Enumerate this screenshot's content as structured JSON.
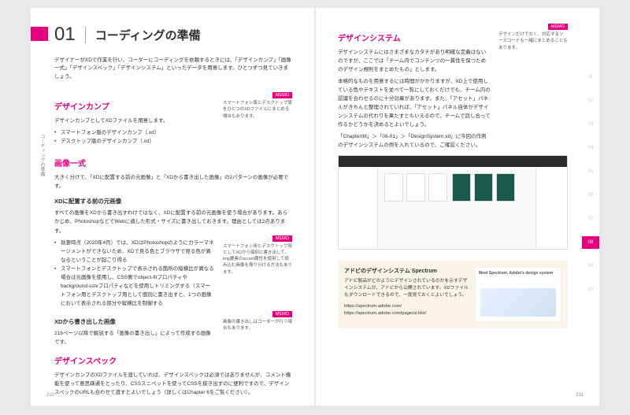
{
  "chapter": {
    "num": "01",
    "title": "コーディングの準備"
  },
  "intro": "デザイナーがXDで作業を行い、コーダーにコーディングを依頼するときには、「デザインカンプ」「画像一式」「デザインスペック」「デザインシステム」といったデータを用意します。ひとつずつ見ていきましょう。",
  "sideLabel": "コーディングの準備",
  "left": {
    "s1": {
      "h": "デザインカンプ",
      "p": "デザインカンプとしてXDファイルを用意します。",
      "b1": "スマートフォン版のデザインカンプ（.xd）",
      "b2": "デスクトップ版のデザインカンプ（.xd）",
      "memo": {
        "tag": "MEMO",
        "body": "スマートフォン版とデスクトップ版をひとつのXDファイルにまとめる場合もあります。"
      }
    },
    "s2": {
      "h": "画像一式",
      "p1": "大きく分けて、「XDに配置する前の元画像」と「XDから書き出した画像」の2パターンの画像が必要です。",
      "sub1": "XDに配置する前の元画像",
      "p2": "すべての画像をXDから書き出すわけではなく、XDに配置する前の元画像を使う場合があります。あらかじめ、PhotoshopなどでWebに適した形式・サイズに書き出しておきます。理由としては2点あります。",
      "b1": "執筆時点（2020年4月）では、XDはPhotoshopのようにカラーマネージメントができないため、XDで見る色とブラウザで見る色が異なるということが起こり得る",
      "b2": "スマートフォンとデスクトップで表示される箇所の縦横比が異なる場合は元画像を使用し、CSS側でobject-fitプロパティやbackground-sizeプロパティなどを使用しトリミングする（スマートフォン用とデスクトップ用として個別に書き出すと、1つの画像において表示される部分や縦横比を制御する",
      "memo1": {
        "tag": "MEMO",
        "body": "スマートフォン用とデスクトップ用としてXDから個別に書き出して、img要素のsrcset属性を使用して読み込む画像を振り分ける方法もあります。"
      },
      "sub2": "XDから書き出した画像",
      "p3": "216ページ以降で解説する「画像の書き出し」によって作成する画像です。",
      "memo2": {
        "tag": "MEMO",
        "body": "画像の書き出しはコーダーが行う場合もあります。"
      }
    },
    "s3": {
      "h": "デザインスペック",
      "p": "デザインカンプのXDファイルを渡していれば、デザインスペックは必須ではありませんが、コメント機能を使って意思疎通をとったり、CSSスニペットを使ってCSSを抜き出すのに便利ですので、デザインスペックのURLも合わせて渡すとよいでしょう（詳しくはChapter 6をご覧ください）。"
    }
  },
  "right": {
    "s4": {
      "h": "デザインシステム",
      "p1": "デザインシステムにはさまざまなカタチがあり明確な定義はないのですが、ここでは「チーム内でコンテンツの一貫性を保つためのデザイン規則をまとめたもの」とします。",
      "p2": "本格的なものを用意するには時間がかかりますが、XD上で使用している色やテキストを並べて一覧にしておくだけでも、チーム内の認識を合わせるのに十分効果があります。また、「アセット」パネルがきちんと整理されていれば、「アセット」パネル自体がデザインシステムの代わりを果たすともいえるので、チームで話し合って作るかどうかを決めるとよいでしょう。",
      "p3": "「Chapter08」＞「08-01」＞「DesignSystem.xd」に今回の作例のデザインシステムの例を入れているので、ご確認ください。",
      "memo": {
        "tag": "MEMO",
        "body": "デザインだけでなく、対応するソースコードも一緒にまとめることもあります。"
      }
    },
    "info": {
      "title": "アドビのデザインシステム Spectrum",
      "p": "アドビ製品がどのようにデザインされているのかを示すデザインシステムが、アドビから公開されています。XDファイルもダウンロードできるので、一度見ておくとよいでしょう。",
      "url1": "https://spectrum.adobe.com/",
      "url2": "https://spectrum.adobe.com/page/ui-kits/",
      "imgHeader": "Meet Spectrum, Adobe's design system"
    }
  },
  "pageNums": {
    "left": "210",
    "right": "211"
  },
  "tabs": [
    "01",
    "02",
    "03",
    "04",
    "05",
    "06",
    "07",
    "08",
    "09",
    "10"
  ],
  "activeTab": "08"
}
